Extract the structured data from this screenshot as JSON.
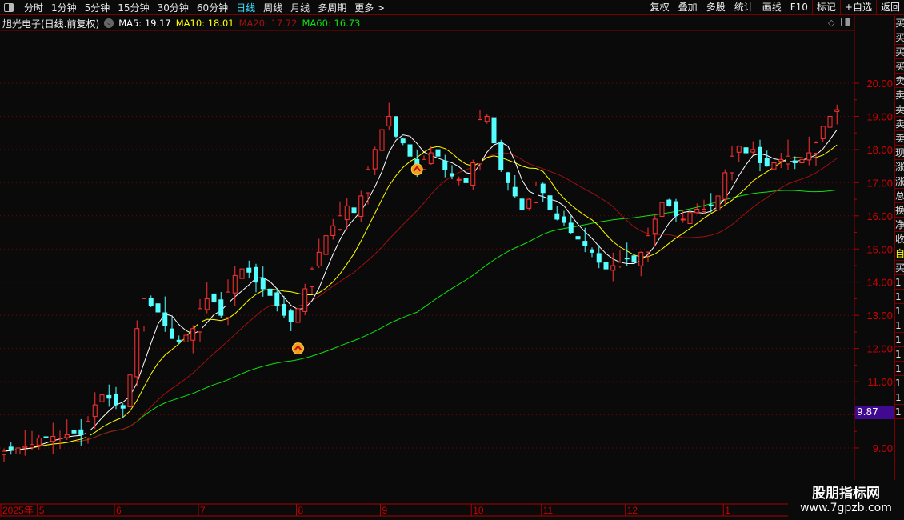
{
  "toolbar": {
    "periods": [
      "分时",
      "1分钟",
      "5分钟",
      "15分钟",
      "30分钟",
      "60分钟",
      "日线",
      "周线",
      "月线",
      "多周期",
      "更多 >"
    ],
    "active": "日线",
    "right_buttons": [
      "复权",
      "叠加",
      "多股",
      "统计",
      "画线",
      "F10",
      "标记",
      "+自选",
      "返回"
    ]
  },
  "info": {
    "title": "旭光电子(日线.前复权)",
    "ma5": "MA5: 19.17",
    "ma10": "MA10: 18.01",
    "ma20": "MA20: 17.72",
    "ma60": "MA60: 16.73"
  },
  "colors": {
    "ma5": "#ffffff",
    "ma10": "#ffff00",
    "ma20": "#a01010",
    "ma60": "#10e010",
    "up": "#ff3232",
    "down": "#54ffff",
    "axis": "#c00000"
  },
  "price_tag": "9.87",
  "right_panel": [
    "买",
    "买",
    "买",
    "买",
    "卖",
    "卖",
    "卖",
    "卖",
    "卖",
    "现",
    "涨",
    "涨",
    "总",
    "换",
    "净",
    "收",
    "自",
    "买",
    "1",
    "1",
    "1",
    "1",
    "1",
    "1",
    "1",
    "1",
    "1",
    "1"
  ],
  "watermark": {
    "line1": "股朋指标网",
    "line2": "www.7gpzb.com"
  },
  "chart_data": {
    "type": "candlestick",
    "y_ticks": [
      "20.00",
      "19.00",
      "18.00",
      "17.00",
      "16.00",
      "15.00",
      "14.00",
      "13.00",
      "12.00",
      "11.00",
      "10.00",
      "9.00"
    ],
    "ylim": [
      8.0,
      21.0
    ],
    "x_labels": [
      {
        "i": 0,
        "label": "2025年"
      },
      {
        "i": 5,
        "label": "5"
      },
      {
        "i": 16,
        "label": "6"
      },
      {
        "i": 28,
        "label": "7"
      },
      {
        "i": 42,
        "label": "8"
      },
      {
        "i": 54,
        "label": "9"
      },
      {
        "i": 67,
        "label": "10"
      },
      {
        "i": 77,
        "label": "11"
      },
      {
        "i": 89,
        "label": "12"
      },
      {
        "i": 103,
        "label": "1"
      }
    ],
    "signals": [
      42,
      59
    ],
    "closes": [
      8.9,
      8.95,
      9.0,
      9.05,
      9.1,
      9.3,
      9.3,
      9.35,
      9.3,
      9.4,
      9.45,
      9.4,
      9.8,
      10.3,
      10.6,
      10.5,
      10.3,
      10.2,
      11.2,
      12.6,
      13.5,
      13.3,
      13.1,
      12.7,
      12.3,
      12.2,
      12.4,
      12.6,
      13.2,
      13.5,
      13.4,
      13.0,
      13.7,
      14.2,
      14.4,
      14.3,
      14.0,
      13.8,
      13.6,
      13.3,
      13.0,
      12.8,
      13.2,
      13.8,
      14.4,
      14.9,
      15.4,
      15.7,
      16.0,
      16.3,
      16.1,
      16.6,
      17.4,
      18.0,
      18.6,
      19.0,
      18.4,
      18.2,
      17.8,
      17.5,
      17.7,
      17.9,
      17.8,
      17.4,
      17.2,
      17.1,
      17.0,
      17.6,
      18.9,
      19.0,
      18.2,
      17.4,
      17.0,
      16.6,
      16.2,
      16.5,
      16.9,
      16.7,
      16.2,
      15.9,
      15.8,
      15.5,
      15.3,
      15.1,
      14.9,
      14.6,
      14.4,
      14.5,
      14.6,
      14.7,
      14.6,
      14.9,
      15.4,
      15.9,
      16.4,
      16.3,
      16.0,
      15.9,
      16.1,
      16.2,
      16.2,
      16.3,
      16.6,
      17.3,
      17.8,
      18.1,
      17.9,
      18.0,
      17.6,
      17.5,
      17.6,
      17.7,
      17.8,
      17.6,
      17.7,
      17.9,
      18.2,
      18.7,
      19.0,
      19.2
    ]
  }
}
